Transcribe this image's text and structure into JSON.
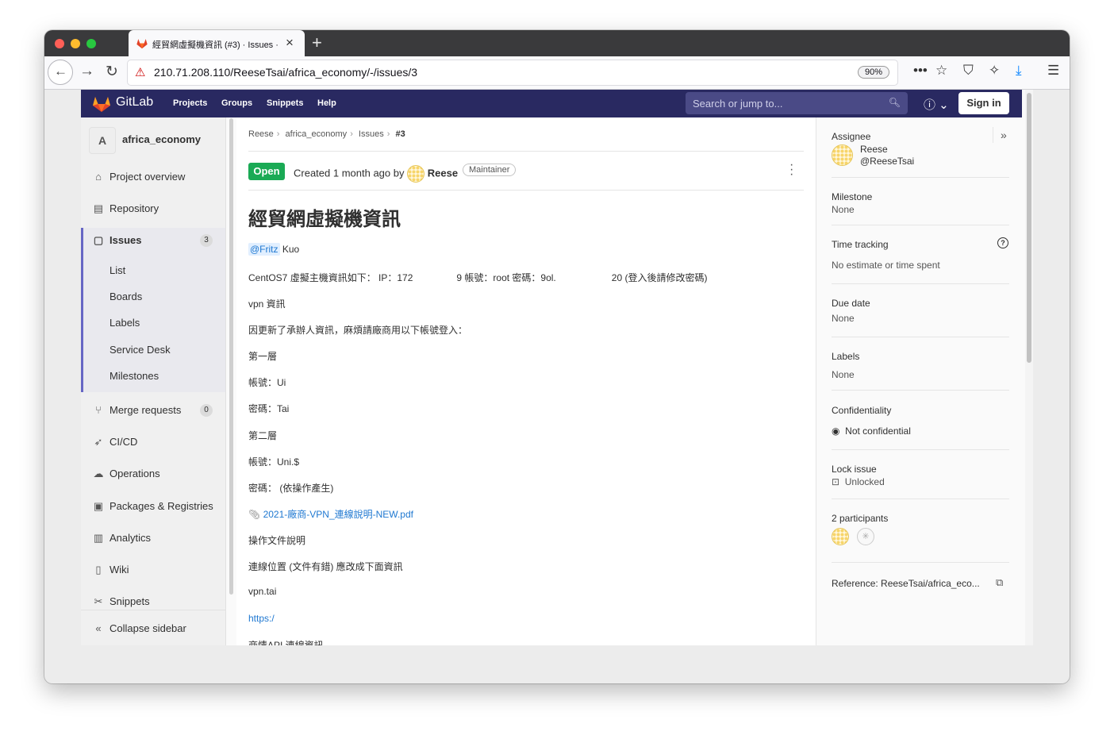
{
  "browser": {
    "tab_title": "經貿網虛擬機資訊 (#3) · Issues · ",
    "url": "210.71.208.110/ReeseTsai/africa_economy/-/issues/3",
    "zoom": "90%"
  },
  "header": {
    "brand": "GitLab",
    "nav": [
      "Projects",
      "Groups",
      "Snippets",
      "Help"
    ],
    "search_placeholder": "Search or jump to...",
    "sign_in": "Sign in"
  },
  "sidebar": {
    "project_initial": "A",
    "project_name": "africa_economy",
    "items": {
      "overview": "Project overview",
      "repository": "Repository",
      "issues": "Issues",
      "issues_count": "3",
      "merge_requests": "Merge requests",
      "mr_count": "0",
      "cicd": "CI/CD",
      "operations": "Operations",
      "packages": "Packages & Registries",
      "analytics": "Analytics",
      "wiki": "Wiki",
      "snippets": "Snippets"
    },
    "sub": [
      "List",
      "Boards",
      "Labels",
      "Service Desk",
      "Milestones"
    ],
    "collapse": "Collapse sidebar"
  },
  "issue": {
    "breadcrumbs": [
      "Reese",
      "africa_economy",
      "Issues",
      "#3"
    ],
    "status": "Open",
    "created": "Created 1 month ago by",
    "author": "Reese",
    "role": "Maintainer",
    "title": "經貿網虛擬機資訊",
    "mention": "@Fritz",
    "mention_rest": " Kuo",
    "line1a": "CentOS7 虛擬主機資訊如下： IP：172",
    "line1b": "9 帳號：root 密碼：9ol.",
    "line1c": "20 (登入後請修改密碼)",
    "vpn": "vpn 資訊",
    "notice": "因更新了承辦人資訊，麻煩請廠商用以下帳號登入：",
    "layer1": "第一層",
    "acc1": "帳號：Ui",
    "pw1": "密碼：Tai",
    "layer2": "第二層",
    "acc2": "帳號：Uni.$",
    "pw2": "密碼： (依操作產生)",
    "attachment": "2021-廠商-VPN_連線說明-NEW.pdf",
    "docnote": "操作文件說明",
    "location": "連線位置 (文件有錯) 應改成下面資訊",
    "vpnhost": "vpn.tai",
    "https": "https:/",
    "api": "商情API 連線資訊"
  },
  "right": {
    "assignee_label": "Assignee",
    "assignee_name": "Reese",
    "assignee_user": "@ReeseTsai",
    "milestone_label": "Milestone",
    "milestone_value": "None",
    "time_label": "Time tracking",
    "time_value": "No estimate or time spent",
    "due_label": "Due date",
    "due_value": "None",
    "labels_label": "Labels",
    "labels_value": "None",
    "conf_label": "Confidentiality",
    "conf_value": "Not confidential",
    "lock_label": "Lock issue",
    "lock_value": "Unlocked",
    "participants": "2 participants",
    "reference": "Reference: ReeseTsai/africa_eco..."
  },
  "colors": {
    "header": "#292961",
    "open": "#1aaa55",
    "link": "#1f78d1"
  }
}
